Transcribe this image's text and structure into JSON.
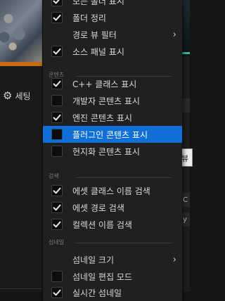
{
  "background": {
    "settings_label": "세팅",
    "right_fragments": [
      "C",
      "y l"
    ],
    "tooltip_text": "뷰"
  },
  "menu": {
    "items_top": [
      {
        "label": "모든 폴더 표시",
        "checked": true
      },
      {
        "label": "폴더 정리",
        "checked": true
      },
      {
        "label": "경로 뷰 필터",
        "submenu": true
      },
      {
        "label": "소스 패널 표시",
        "checked": true
      }
    ],
    "section_content": "콘텐츠",
    "items_content": [
      {
        "label": "C++ 클래스 표시",
        "checked": true
      },
      {
        "label": "개발자 콘텐츠 표시",
        "checked": false
      },
      {
        "label": "엔진 콘텐츠 표시",
        "checked": true
      },
      {
        "label": "플러그인 콘텐츠 표시",
        "checked": false,
        "highlighted": true
      },
      {
        "label": "현지화 콘텐츠 표시",
        "checked": false
      }
    ],
    "section_search": "검색",
    "items_search": [
      {
        "label": "에셋 클래스 이름 검색",
        "checked": true
      },
      {
        "label": "에셋 경로 검색",
        "checked": true
      },
      {
        "label": "컬렉션 이름 검색",
        "checked": true
      }
    ],
    "section_thumbnail": "섬네일",
    "items_thumbnail": [
      {
        "label": "섬네일 크기",
        "submenu": true
      },
      {
        "label": "섬네일 편집 모드",
        "checked": false
      },
      {
        "label": "실시간 섬네일",
        "checked": true
      }
    ]
  },
  "colors": {
    "highlight": "#0f6fd6",
    "menu_bg": "#202020",
    "accent_orange": "#c86a12",
    "accent_teal": "#2fb9a8"
  }
}
